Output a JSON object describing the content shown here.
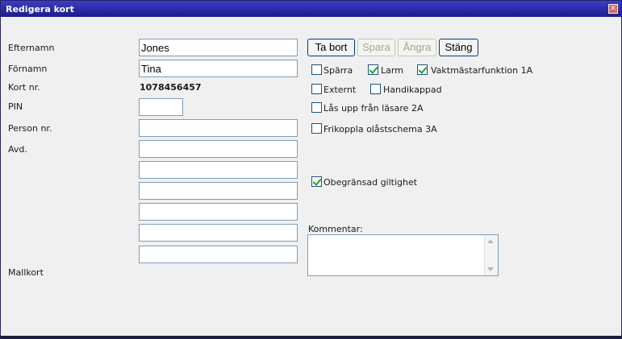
{
  "window": {
    "title": "Redigera kort",
    "close_glyph": "✕"
  },
  "labels": {
    "efternamn": "Efternamn",
    "fornamn": "Förnamn",
    "kortnr": "Kort nr.",
    "pin": "PIN",
    "personnr": "Person nr.",
    "avd": "Avd.",
    "mallkort": "Mallkort",
    "kommentar": "Kommentar:"
  },
  "fields": {
    "efternamn": "Jones",
    "fornamn": "Tina",
    "kortnr": "1078456457",
    "pin": "",
    "personnr": "",
    "avd": "",
    "extra1": "",
    "extra2": "",
    "extra3": "",
    "extra4": "",
    "extra5": "",
    "kommentar": ""
  },
  "buttons": {
    "ta_bort": "Ta bort",
    "spara": "Spara",
    "angra": "Ångra",
    "stang": "Stäng"
  },
  "checkboxes": {
    "sparra": {
      "label": "Spärra",
      "checked": false
    },
    "larm": {
      "label": "Larm",
      "checked": true
    },
    "vaktmastar": {
      "label": "Vaktmästarfunktion 1A",
      "checked": true
    },
    "externt": {
      "label": "Externt",
      "checked": false
    },
    "handikappad": {
      "label": "Handikappad",
      "checked": false
    },
    "las_upp": {
      "label": "Lås upp från läsare 2A",
      "checked": false
    },
    "frikoppla": {
      "label": "Frikoppla olåstschema 3A",
      "checked": false
    },
    "obegransad": {
      "label": "Obegränsad giltighet",
      "checked": true
    }
  },
  "colors": {
    "titlebar": "#1d1d8c",
    "window_bg": "#f0f0f0",
    "checkmark": "#21a121",
    "input_border": "#7f9db9"
  }
}
